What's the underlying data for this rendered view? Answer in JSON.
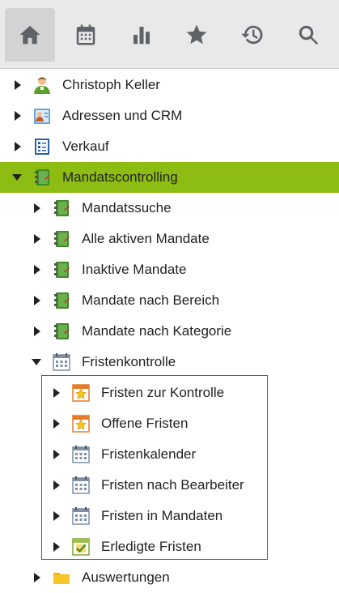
{
  "toolbar": {
    "buttons": [
      {
        "name": "home-icon",
        "active": true
      },
      {
        "name": "calendar-icon",
        "active": false
      },
      {
        "name": "bar-chart-icon",
        "active": false
      },
      {
        "name": "star-icon",
        "active": false
      },
      {
        "name": "history-icon",
        "active": false
      },
      {
        "name": "search-icon",
        "active": false
      }
    ]
  },
  "tree": {
    "items": [
      {
        "label": "Christoph Keller",
        "icon": "person-icon",
        "expanded": false
      },
      {
        "label": "Adressen und CRM",
        "icon": "address-book-icon",
        "expanded": false
      },
      {
        "label": "Verkauf",
        "icon": "sales-list-icon",
        "expanded": false
      },
      {
        "label": "Mandatscontrolling",
        "icon": "mandate-binder-icon",
        "expanded": true,
        "selected": true
      },
      {
        "label": "Mandatssuche",
        "icon": "mandate-binder-icon",
        "expanded": false
      },
      {
        "label": "Alle aktiven Mandate",
        "icon": "mandate-binder-icon",
        "expanded": false
      },
      {
        "label": "Inaktive Mandate",
        "icon": "mandate-binder-icon",
        "expanded": false
      },
      {
        "label": "Mandate nach Bereich",
        "icon": "mandate-binder-icon",
        "expanded": false
      },
      {
        "label": "Mandate nach Kategorie",
        "icon": "mandate-binder-icon",
        "expanded": false
      },
      {
        "label": "Fristenkontrolle",
        "icon": "calendar-grid-icon",
        "expanded": true
      },
      {
        "label": "Fristen zur Kontrolle",
        "icon": "deadline-star-icon",
        "expanded": false
      },
      {
        "label": "Offene Fristen",
        "icon": "deadline-star-icon",
        "expanded": false
      },
      {
        "label": "Fristenkalender",
        "icon": "calendar-grid-icon",
        "expanded": false
      },
      {
        "label": "Fristen nach Bearbeiter",
        "icon": "calendar-grid-icon",
        "expanded": false
      },
      {
        "label": "Fristen in Mandaten",
        "icon": "calendar-grid-icon",
        "expanded": false
      },
      {
        "label": "Erledigte Fristen",
        "icon": "done-check-icon",
        "expanded": false
      },
      {
        "label": "Auswertungen",
        "icon": "folder-icon",
        "expanded": false
      }
    ]
  },
  "colors": {
    "selected_row": "#8dbd12",
    "highlight_border": "#d32c2c"
  }
}
